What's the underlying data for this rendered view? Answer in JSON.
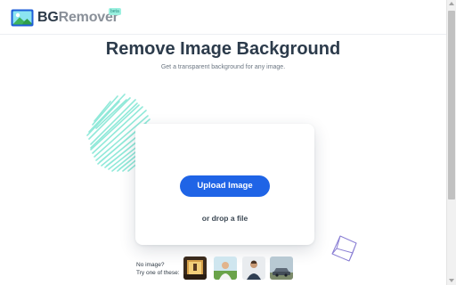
{
  "header": {
    "brand_bold": "BG",
    "brand_light": "Remover",
    "beta_badge": "beta",
    "logo_icon": "image-landscape-icon"
  },
  "hero": {
    "title": "Remove Image Background",
    "subtitle": "Get a transparent background for any image."
  },
  "upload": {
    "button_label": "Upload Image",
    "drop_text": "or drop a file"
  },
  "samples": {
    "line1": "No image?",
    "line2": "Try one of these:",
    "thumbnails": [
      "sample-image-1",
      "sample-image-2",
      "sample-image-3",
      "sample-image-4"
    ]
  },
  "colors": {
    "primary": "#1f64e6",
    "accent": "#9bf0df",
    "heading": "#2c3b4b",
    "cube": "#8a7fd4"
  }
}
